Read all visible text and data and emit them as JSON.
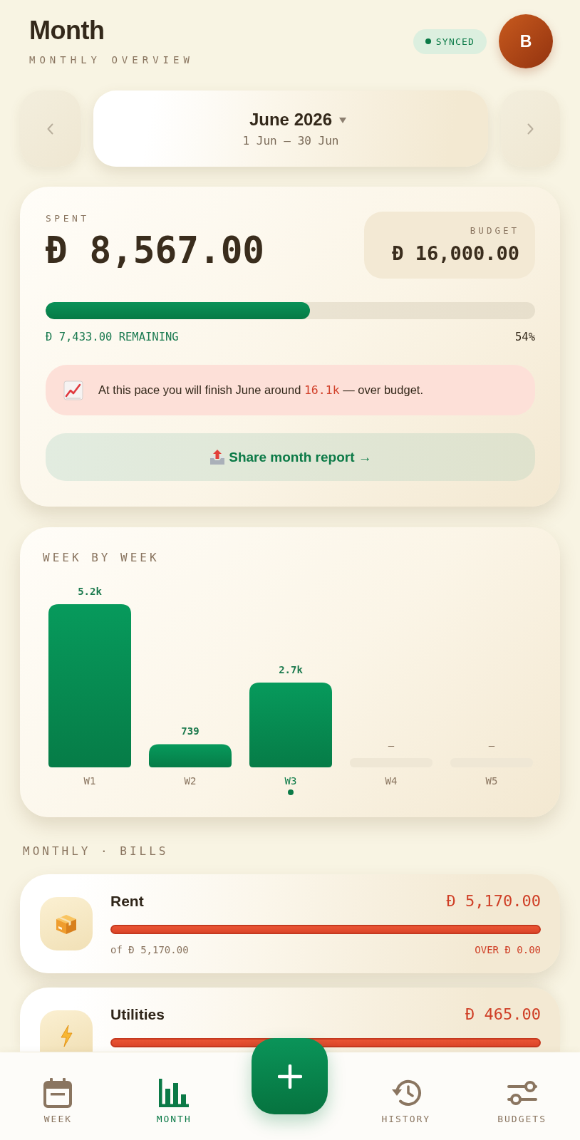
{
  "header": {
    "title": "Month",
    "subtitle": "MONTHLY OVERVIEW",
    "sync_status": "SYNCED",
    "avatar_initial": "B"
  },
  "period": {
    "label": "June 2026",
    "range": "1 Jun — 30 Jun"
  },
  "summary": {
    "spent_label": "SPENT",
    "spent": "Đ 8,567.00",
    "budget_label": "BUDGET",
    "budget": "Đ 16,000.00",
    "level": 0.54,
    "remaining": "Đ 7,433.00 REMAINING",
    "percent": "54%",
    "forecast": "At this pace you will finish June around **16.1k** — over budget.",
    "share_label": "Share month report →"
  },
  "weekly": {
    "title": "WEEK BY WEEK",
    "chart_data": {
      "type": "bar",
      "categories": [
        "W1",
        "W2",
        "W3",
        "W4",
        "W5"
      ],
      "values": [
        5200,
        739,
        2700,
        null,
        null
      ],
      "value_labels": [
        "5.2k",
        "739",
        "2.7k",
        "–",
        "–"
      ]
    },
    "weeks": [
      {
        "selected": false
      },
      {
        "selected": false
      },
      {
        "selected": true
      },
      {
        "selected": false
      },
      {
        "selected": false
      }
    ]
  },
  "bills": {
    "title": "MONTHLY · BILLS",
    "items": [
      {
        "kind": "package",
        "name": "Rent",
        "amount": "Đ 5,170.00",
        "over": true,
        "level": 1,
        "limit": "of Đ 5,170.00",
        "status": "OVER Đ 0.00"
      },
      {
        "kind": "bolt",
        "name": "Utilities",
        "amount": "Đ 465.00",
        "over": true,
        "level": 1
      }
    ]
  },
  "nav": {
    "items": [
      {
        "kind": "calendar",
        "label": "WEEK",
        "selected": false
      },
      {
        "kind": "chart",
        "label": "MONTH",
        "selected": true
      },
      {
        "kind": "history",
        "label": "HISTORY",
        "selected": false
      },
      {
        "kind": "sliders",
        "label": "BUDGETS",
        "selected": false
      }
    ]
  }
}
